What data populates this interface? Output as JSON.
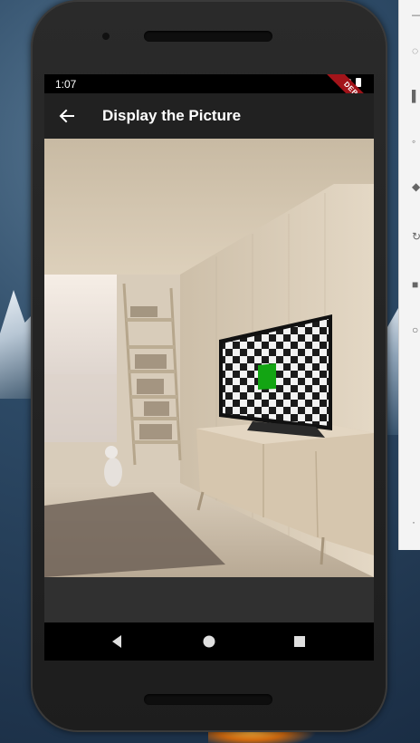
{
  "status_bar": {
    "time": "1:07",
    "icons": "▼ ▮",
    "debug_banner": "DEBUG"
  },
  "app_bar": {
    "back_icon": "arrow-back-icon",
    "title": "Display the Picture"
  },
  "picture": {
    "description_icon": "room-with-tv-image"
  },
  "navigation": {
    "back": "nav-back-icon",
    "home": "nav-home-icon",
    "recents": "nav-recents-icon"
  },
  "colors": {
    "app_bar": "#212121",
    "background": "#303030",
    "debug": "#a3141a"
  }
}
